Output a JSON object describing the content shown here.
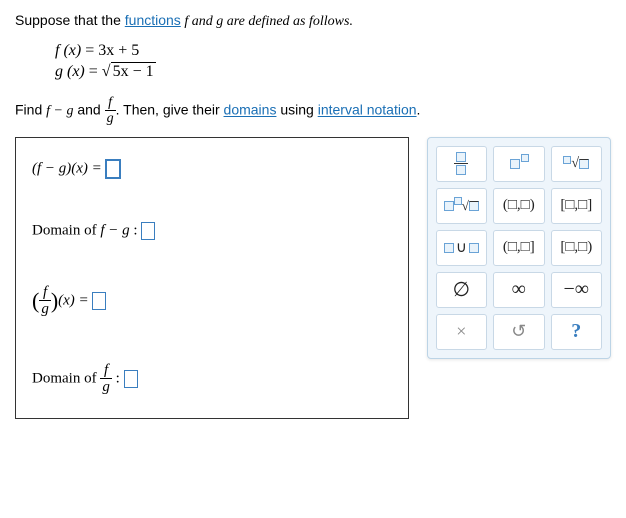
{
  "instr": {
    "prefix": "Suppose that the ",
    "link_functions": "functions",
    "mid": " f and g are defined as follows."
  },
  "defs": {
    "f_lhs": "f (x) ",
    "f_rhs": "= 3x + 5",
    "g_lhs": "g (x) ",
    "g_eq": "= ",
    "g_radicand": "5x − 1"
  },
  "task": {
    "p1": "Find ",
    "diff": "f − g",
    "p2": " and ",
    "frac_num": "f",
    "frac_den": "g",
    "p3": ". Then, give their ",
    "link_domains": "domains",
    "p4": " using ",
    "link_interval": "interval notation",
    "p5": "."
  },
  "answers": {
    "r1_lhs": "(f − g)(x) = ",
    "r2_lhs_a": "Domain of ",
    "r2_lhs_b": "f − g",
    "r2_lhs_c": " : ",
    "r3_num": "f",
    "r3_den": "g",
    "r3_rhs": "(x) = ",
    "r4_a": "Domain of ",
    "r4_num": "f",
    "r4_den": "g",
    "r4_c": " : "
  },
  "keypad": {
    "k7": "(□,□)",
    "k8": "[□,□]",
    "k10": "(□,□]",
    "k11": "[□,□)",
    "k12": "∅",
    "k13": "∞",
    "k14": "−∞",
    "k15": "×",
    "k16": "↺",
    "k17": "?"
  }
}
